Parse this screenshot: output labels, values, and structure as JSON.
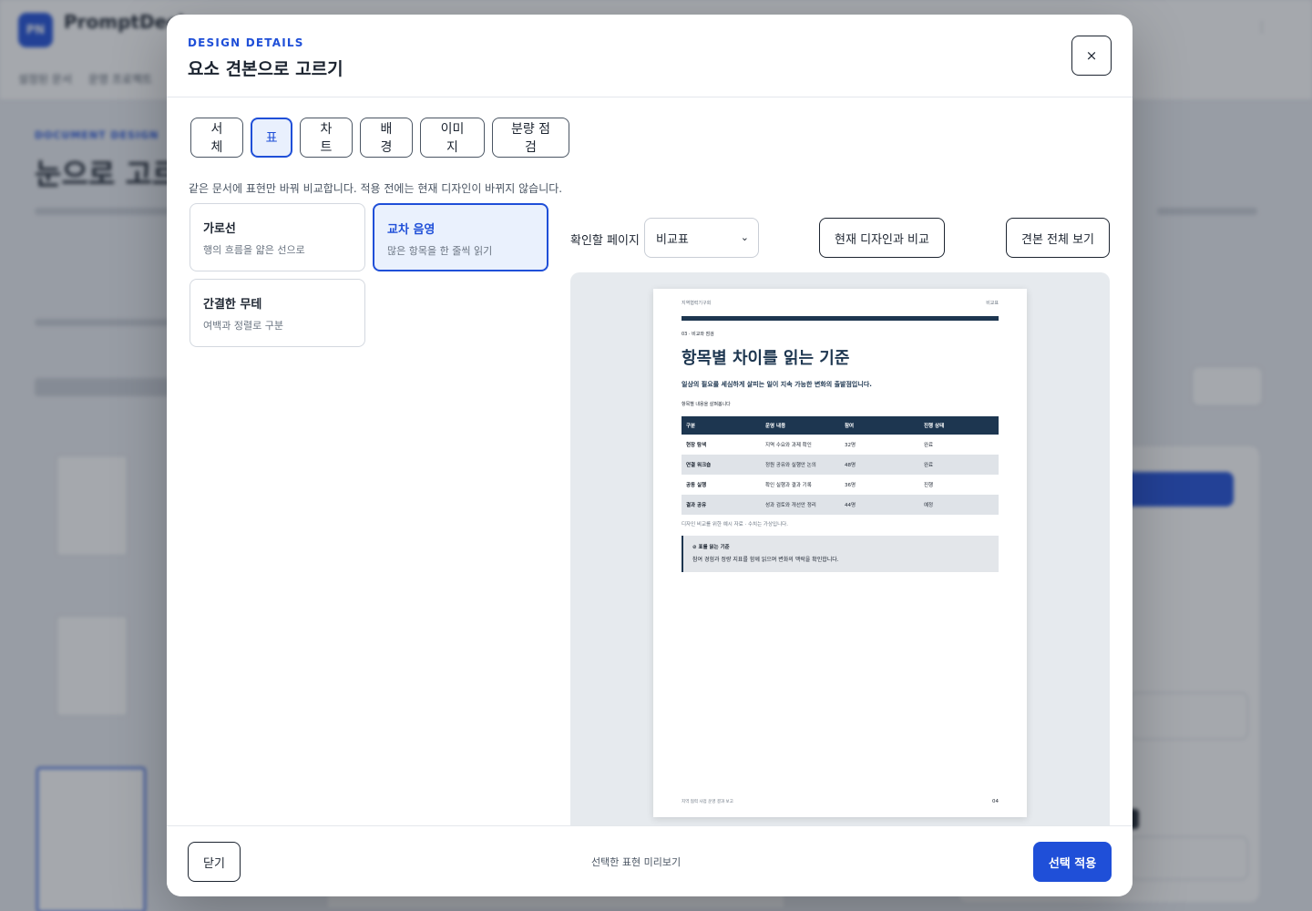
{
  "background_app": {
    "logo_text": "PN",
    "brand": "PromptDeck",
    "nav_items": [
      "설정된 문서",
      "운영 프로젝트"
    ],
    "eyebrow": "DOCUMENT DESIGN",
    "title": "눈으로 고르기"
  },
  "modal": {
    "eyebrow": "DESIGN DETAILS",
    "title": "요소 견본으로 고르기",
    "close_icon": "×"
  },
  "tabs": [
    {
      "label": "서체",
      "active": false
    },
    {
      "label": "표",
      "active": true
    },
    {
      "label": "차트",
      "active": false
    },
    {
      "label": "배경",
      "active": false
    },
    {
      "label": "이미지",
      "active": false
    },
    {
      "label": "분량 점검",
      "active": false
    }
  ],
  "helper_text": "같은 문서에 표현만 바꿔 비교합니다. 적용 전에는 현재 디자인이 바뀌지 않습니다.",
  "options": [
    {
      "title": "가로선",
      "desc": "행의 흐름을 얇은 선으로",
      "selected": false
    },
    {
      "title": "교차 음영",
      "desc": "많은 항목을 한 줄씩 읽기",
      "selected": true
    },
    {
      "title": "간결한 무테",
      "desc": "여백과 정렬로 구분",
      "selected": false
    }
  ],
  "preview_controls": {
    "page_label": "확인할 페이지",
    "page_value": "비교표",
    "compare_button": "현재 디자인과 비교",
    "full_button": "견본 전체 보기"
  },
  "preview_page": {
    "org": "지역협력기구회",
    "tag": "비교표",
    "section": "03 · 비교와 점검",
    "heading": "항목별 차이를 읽는 기준",
    "lead": "일상의 필요를 세심하게 살피는 일이 지속 가능한 변화의 출발점입니다.",
    "caption": "항목별 내용을 살펴봅니다",
    "table": {
      "headers": [
        "구분",
        "운영 내용",
        "참여",
        "진행 상태"
      ],
      "rows": [
        [
          "현장 탐색",
          "지역 수요와 과제 확인",
          "32명",
          "완료"
        ],
        [
          "연결 워크숍",
          "정원 공유와 실행안 논의",
          "48명",
          "완료"
        ],
        [
          "공동 실행",
          "확인 실행과 결과 기록",
          "36명",
          "진행"
        ],
        [
          "결과 공유",
          "성과 검토와 개선안 정리",
          "44명",
          "예정"
        ]
      ]
    },
    "note": "디자인 비교를 위한 예시 자료 · 수치는 가상입니다.",
    "box_title": "⊘ 표를 읽는 기준",
    "box_body": "참여 경험과 정량 지표를 함께 읽으며 변화의 맥락을 확인합니다.",
    "footer": "지역 협력 사업 운영 결과 보고",
    "page_number": "04"
  },
  "footer": {
    "close_label": "닫기",
    "middle_text": "선택한 표현 미리보기",
    "apply_label": "선택 적용"
  },
  "colors": {
    "accent": "#1f4fd8",
    "navy": "#1d3650"
  }
}
